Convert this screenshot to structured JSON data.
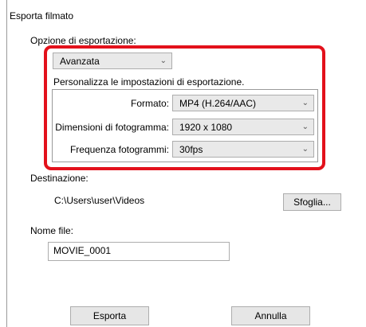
{
  "dialog": {
    "title": "Esporta filmato"
  },
  "export_options": {
    "label": "Opzione di esportazione:",
    "preset": {
      "selected": "Avanzata"
    },
    "description": "Personalizza le impostazioni di esportazione.",
    "format": {
      "label": "Formato:",
      "selected": "MP4 (H.264/AAC)"
    },
    "frame_size": {
      "label": "Dimensioni di fotogramma:",
      "selected": "1920 x 1080"
    },
    "frame_rate": {
      "label": "Frequenza fotogrammi:",
      "selected": "30fps"
    }
  },
  "destination": {
    "label": "Destinazione:",
    "path": "C:\\Users\\user\\Videos",
    "browse_label": "Sfoglia..."
  },
  "filename": {
    "label": "Nome file:",
    "value": "MOVIE_0001"
  },
  "actions": {
    "export_label": "Esporta",
    "cancel_label": "Annulla"
  },
  "icons": {
    "dropdown": "chevron-down-icon"
  },
  "colors": {
    "highlight": "#e3111b",
    "button_bg": "#e6e6e6",
    "combo_bg": "#e9e9e9"
  }
}
